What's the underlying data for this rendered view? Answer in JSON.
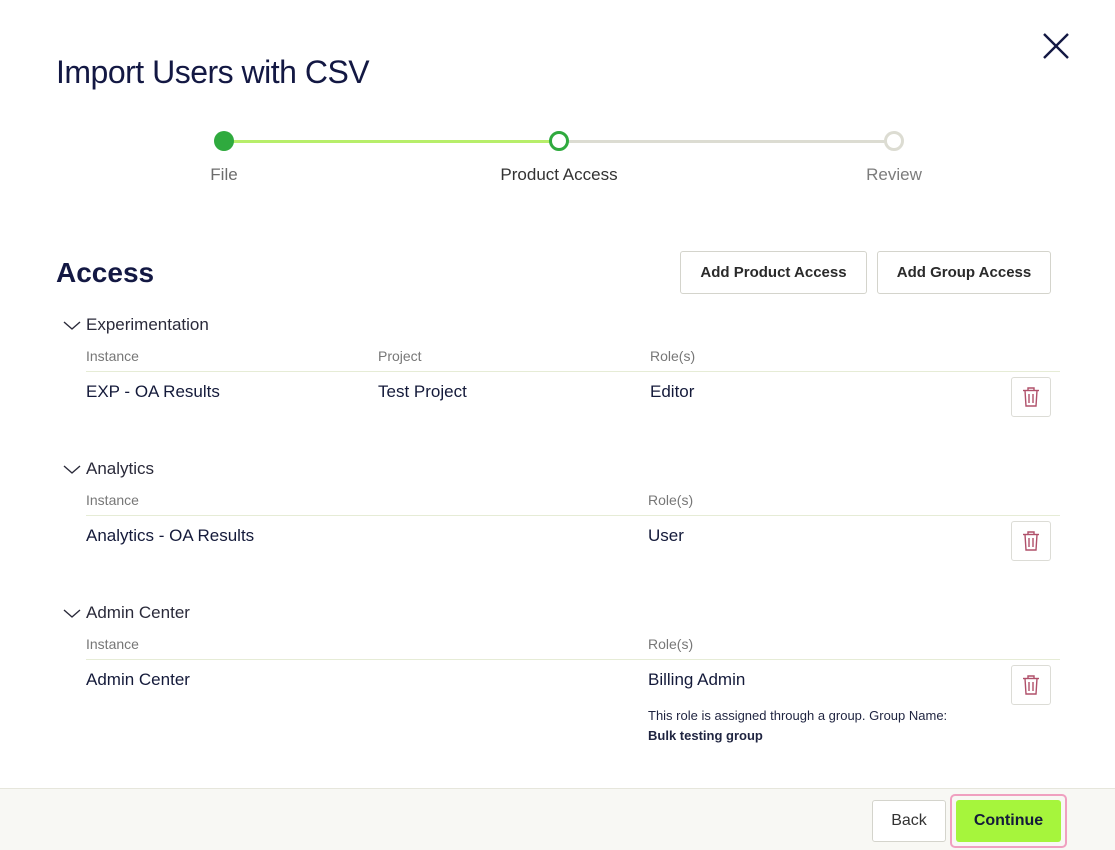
{
  "dialog": {
    "title": "Import Users with CSV",
    "close_icon": "close-icon"
  },
  "stepper": {
    "steps": [
      {
        "label": "File",
        "state": "completed"
      },
      {
        "label": "Product Access",
        "state": "current"
      },
      {
        "label": "Review",
        "state": "upcoming"
      }
    ],
    "colors": {
      "active": "#2faa3e",
      "progress": "#b7ee6a",
      "inactive": "#dcdcd2"
    }
  },
  "access": {
    "heading": "Access",
    "add_product_label": "Add Product Access",
    "add_group_label": "Add Group Access"
  },
  "sections": [
    {
      "title": "Experimentation",
      "columns": {
        "instance": "Instance",
        "project": "Project",
        "roles": "Role(s)"
      },
      "row": {
        "instance": "EXP - OA Results",
        "project": "Test Project",
        "roles": "Editor"
      }
    },
    {
      "title": "Analytics",
      "columns": {
        "instance": "Instance",
        "roles": "Role(s)"
      },
      "row": {
        "instance": "Analytics - OA Results",
        "roles": "User"
      }
    },
    {
      "title": "Admin Center",
      "columns": {
        "instance": "Instance",
        "roles": "Role(s)"
      },
      "row": {
        "instance": "Admin Center",
        "roles": "Billing Admin",
        "note": "This role is assigned through a group. Group Name:",
        "group_name": "Bulk testing group"
      }
    }
  ],
  "footer": {
    "back_label": "Back",
    "continue_label": "Continue",
    "continue_color": "#a6f53c"
  }
}
